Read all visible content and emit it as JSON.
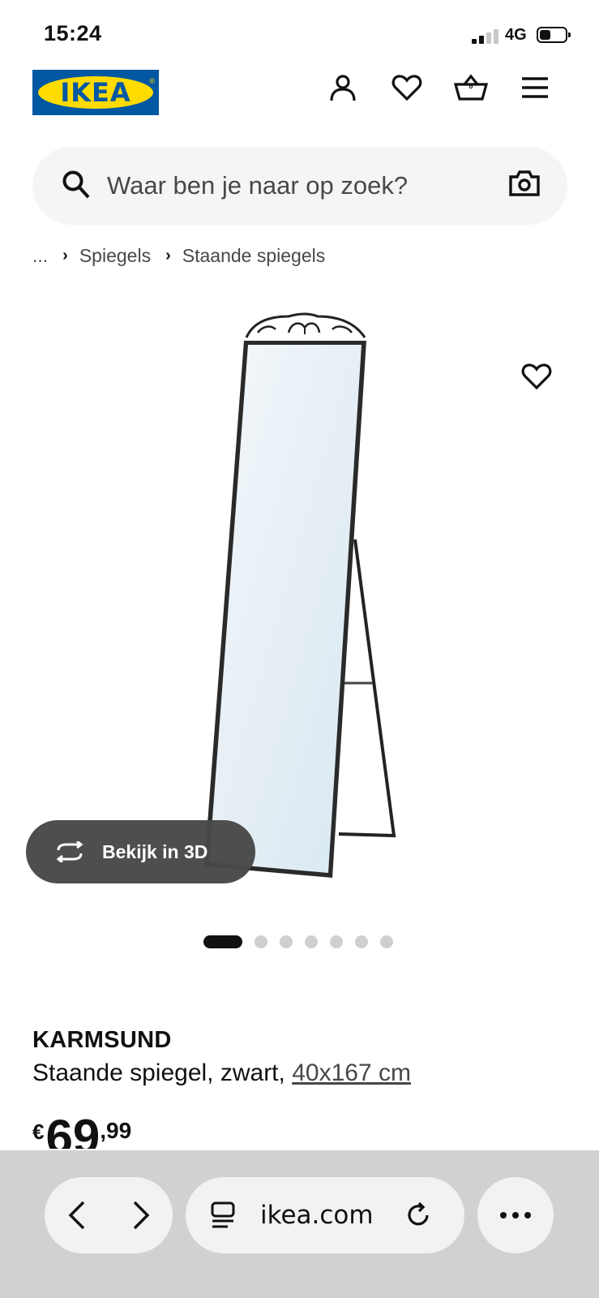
{
  "status_bar": {
    "time": "15:24",
    "network": "4G"
  },
  "header": {
    "logo_text": "IKEA",
    "icons": [
      "user-icon",
      "heart-icon",
      "basket-icon",
      "menu-icon"
    ]
  },
  "search": {
    "placeholder": "Waar ben je naar op zoek?",
    "camera_icon": "camera-icon"
  },
  "breadcrumb": {
    "ellipsis": "...",
    "items": [
      "Spiegels",
      "Staande spiegels"
    ]
  },
  "gallery": {
    "view_3d_label": "Bekijk in 3D",
    "image_count": 7,
    "active_index": 0
  },
  "product": {
    "name": "KARMSUND",
    "description": "Staande spiegel, zwart,",
    "size": "40x167 cm",
    "price_currency": "€",
    "price_main": "69",
    "price_decimals": ",99"
  },
  "browser": {
    "url": "ikea.com"
  },
  "colors": {
    "ikea_blue": "#0058a3",
    "ikea_yellow": "#ffdb00",
    "pill_bg": "#484848"
  }
}
